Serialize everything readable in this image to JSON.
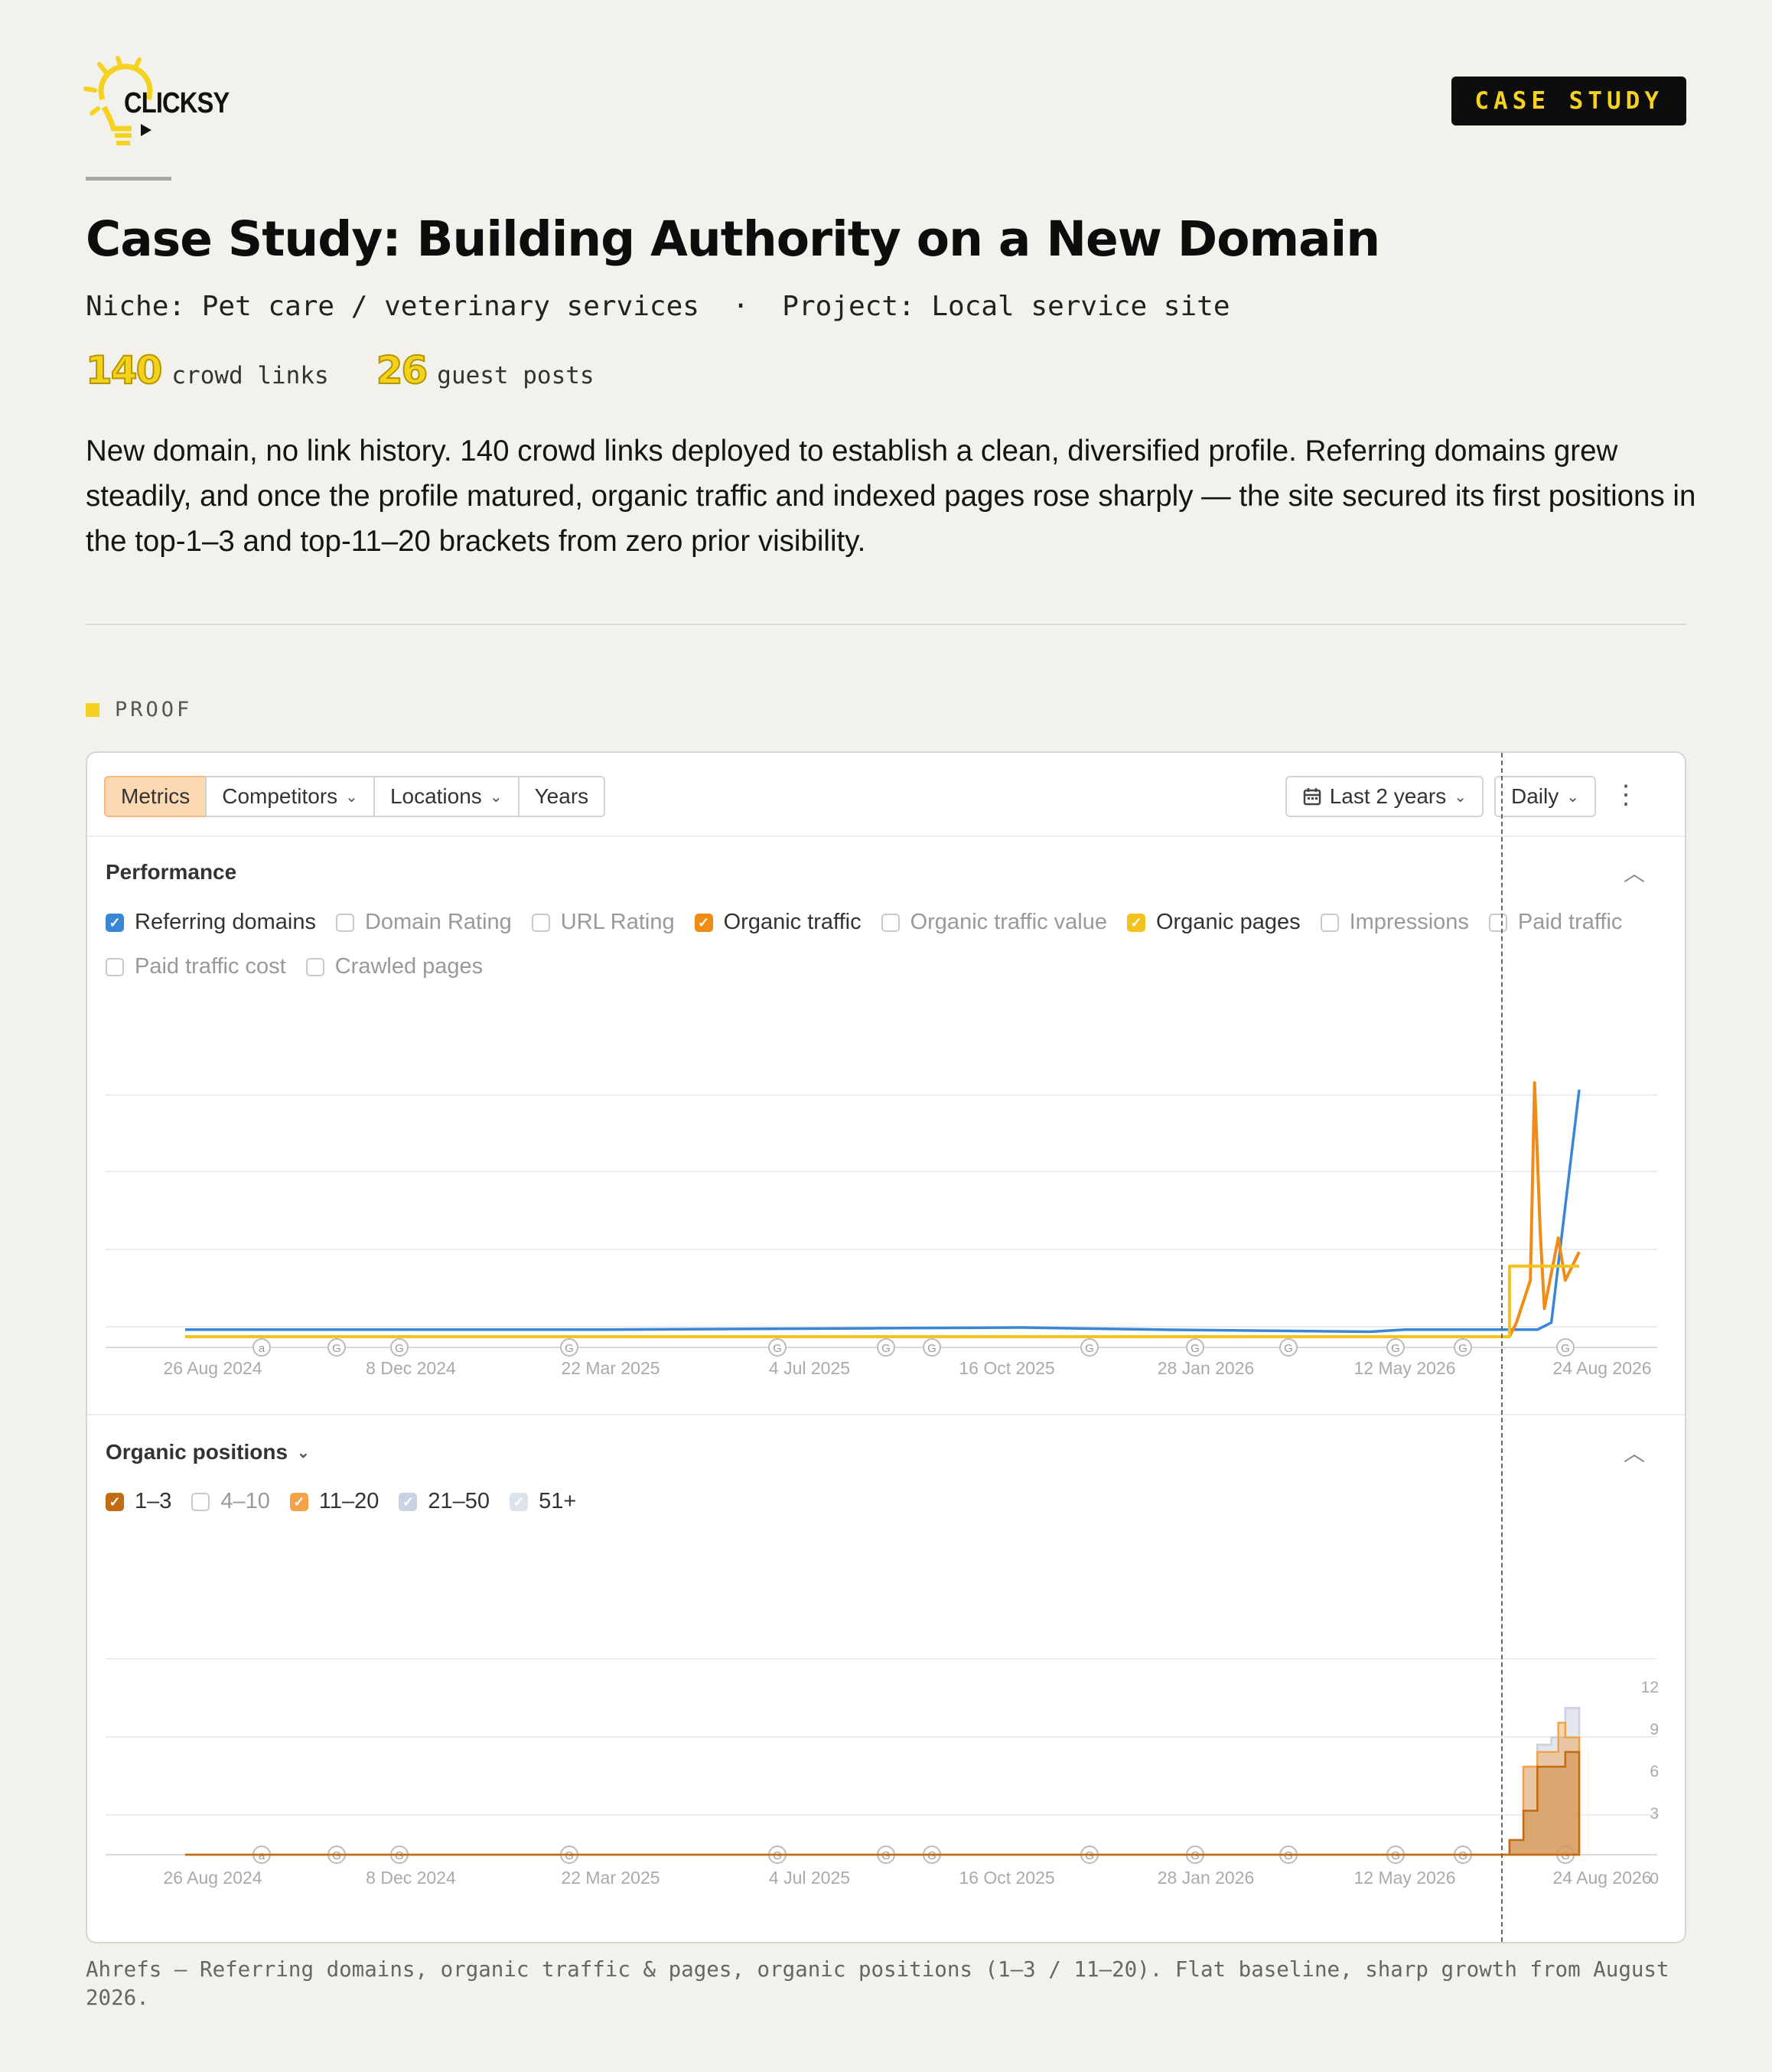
{
  "brand": {
    "name": "CLICKSY",
    "badge": "CASE STUDY",
    "accent": "#f4d21f"
  },
  "header": {
    "title": "Case Study: Building Authority on a New Domain",
    "niche": "Niche: Pet care / veterinary services  ·  Project: Local service site",
    "stats": [
      {
        "value": "140",
        "label": "crowd links"
      },
      {
        "value": "26",
        "label": "guest posts"
      }
    ],
    "description": "New domain, no link history. 140 crowd links deployed to establish a clean, diversified profile. Referring domains grew steadily, and once the profile matured, organic traffic and indexed pages rose sharply — the site secured its first positions in the top-1–3 and top-11–20 brackets from zero prior visibility."
  },
  "proof_label": "PROOF",
  "toolbar": {
    "tabs": [
      {
        "label": "Metrics",
        "active": true,
        "dropdown": false
      },
      {
        "label": "Competitors",
        "active": false,
        "dropdown": true
      },
      {
        "label": "Locations",
        "active": false,
        "dropdown": true
      },
      {
        "label": "Years",
        "active": false,
        "dropdown": false
      }
    ],
    "range": "Last 2 years",
    "interval": "Daily",
    "range_icon": "calendar-icon",
    "more_icon": "kebab-icon"
  },
  "performance": {
    "title": "Performance",
    "checkboxes": [
      {
        "label": "Referring domains",
        "checked": true,
        "color": "#3a86d6"
      },
      {
        "label": "Domain Rating",
        "checked": false
      },
      {
        "label": "URL Rating",
        "checked": false
      },
      {
        "label": "Organic traffic",
        "checked": true,
        "color": "#f08c16"
      },
      {
        "label": "Organic traffic value",
        "checked": false
      },
      {
        "label": "Organic pages",
        "checked": true,
        "color": "#f4c21c"
      },
      {
        "label": "Impressions",
        "checked": false
      },
      {
        "label": "Paid traffic",
        "checked": false
      },
      {
        "label": "Paid traffic cost",
        "checked": false
      },
      {
        "label": "Crawled pages",
        "checked": false
      }
    ]
  },
  "positions": {
    "title": "Organic positions",
    "checkboxes": [
      {
        "label": "1–3",
        "checked": true,
        "color": "#c26b12"
      },
      {
        "label": "4–10",
        "checked": false
      },
      {
        "label": "11–20",
        "checked": true,
        "color": "#f4a24a"
      },
      {
        "label": "21–50",
        "checked": true,
        "color": "#c8d2e2"
      },
      {
        "label": "51+",
        "checked": true,
        "color": "#dde3ec"
      }
    ]
  },
  "chart_data": [
    {
      "type": "line",
      "x_ticks": [
        "26 Aug 2024",
        "8 Dec 2024",
        "22 Mar 2025",
        "4 Jul 2025",
        "16 Oct 2025",
        "28 Jan 2026",
        "12 May 2026",
        "24 Aug 2026"
      ],
      "event_markers": [
        "a",
        "G",
        "GG",
        "G",
        "G",
        "G",
        "Ga",
        "G",
        "G",
        "G",
        "G",
        "G",
        "G"
      ],
      "series": [
        {
          "name": "Referring domains",
          "color": "#3a86d6",
          "x": [
            0,
            0.3,
            0.5,
            0.6,
            0.7,
            0.85,
            0.875,
            0.9,
            0.95,
            0.97,
            0.98,
            1.0
          ],
          "y": [
            1,
            1,
            1.2,
            1.3,
            1,
            0.7,
            1,
            1,
            1,
            1,
            2,
            35
          ]
        },
        {
          "name": "Organic traffic",
          "color": "#f08c16",
          "x": [
            0,
            0.95,
            0.955,
            0.965,
            0.968,
            0.972,
            0.975,
            0.98,
            0.985,
            0.99,
            0.995,
            1.0
          ],
          "y": [
            0,
            0,
            2,
            8,
            36,
            15,
            4,
            9,
            14,
            8,
            10,
            12
          ]
        },
        {
          "name": "Organic pages",
          "color": "#f4c21c",
          "x": [
            0,
            0.95,
            0.95,
            1.0
          ],
          "y": [
            0,
            0,
            10,
            10
          ]
        }
      ]
    },
    {
      "type": "area",
      "x_ticks": [
        "26 Aug 2024",
        "8 Dec 2024",
        "22 Mar 2025",
        "4 Jul 2025",
        "16 Oct 2025",
        "28 Jan 2026",
        "12 May 2026",
        "24 Aug 2026"
      ],
      "y_ticks": [
        "0",
        "3",
        "6",
        "9",
        "12"
      ],
      "ylim": [
        0,
        12
      ],
      "series": [
        {
          "name": "1–3",
          "color": "#c26b12",
          "x": [
            0,
            0.95,
            0.96,
            0.97,
            0.98,
            0.99,
            1.0
          ],
          "y": [
            0,
            1,
            3,
            6,
            6,
            7,
            7
          ]
        },
        {
          "name": "11–20",
          "color": "#f4a24a",
          "x": [
            0,
            0.95,
            0.96,
            0.97,
            0.98,
            0.985,
            0.99,
            1.0
          ],
          "y": [
            0,
            1,
            6,
            7,
            7,
            9,
            8,
            7
          ]
        },
        {
          "name": "21–50",
          "color": "#c8d2e2",
          "x": [
            0,
            0.95,
            0.96,
            0.97,
            0.98,
            0.99,
            1.0
          ],
          "y": [
            0,
            1,
            6,
            7.5,
            8,
            10,
            8
          ]
        }
      ]
    }
  ],
  "caption": "Ahrefs — Referring domains, organic traffic & pages, organic positions (1–3 / 11–20). Flat baseline, sharp growth from August 2026."
}
